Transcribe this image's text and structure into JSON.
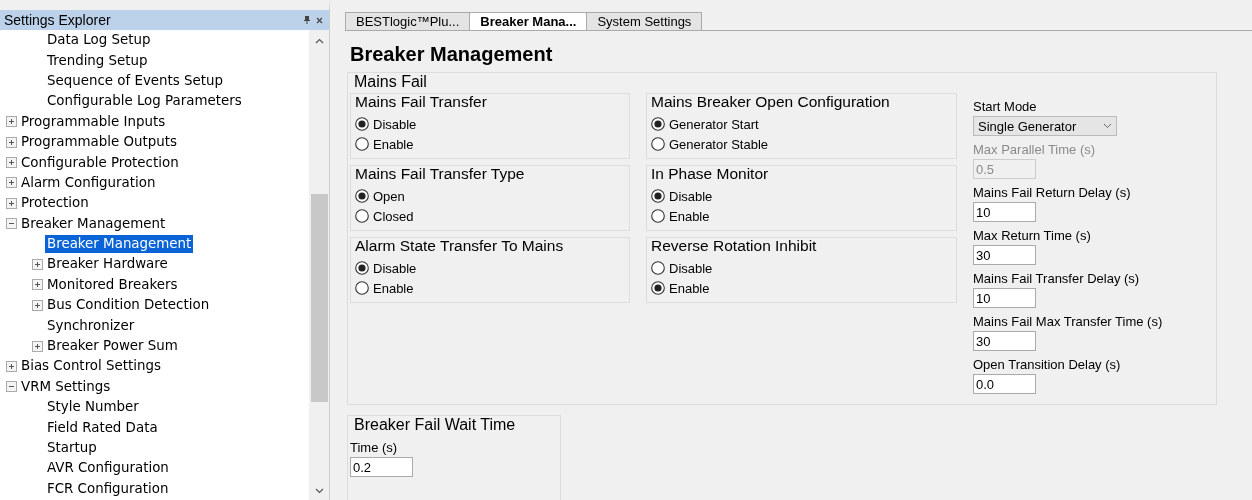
{
  "explorer": {
    "title": "Settings Explorer",
    "tree": [
      {
        "children": [
          {
            "label": "Data Log Setup",
            "selected": false
          },
          {
            "label": "Trending Setup",
            "selected": false
          },
          {
            "label": "Sequence of Events Setup",
            "selected": false
          },
          {
            "label": "Configurable Log Parameters",
            "selected": false
          }
        ]
      },
      {
        "label": "Programmable Inputs",
        "expanded": false,
        "selected": false
      },
      {
        "label": "Programmable Outputs",
        "expanded": false,
        "selected": false
      },
      {
        "label": "Configurable Protection",
        "expanded": false,
        "selected": false
      },
      {
        "label": "Alarm Configuration",
        "expanded": false,
        "selected": false
      },
      {
        "label": "Protection",
        "expanded": false,
        "selected": false
      },
      {
        "label": "Breaker Management",
        "expanded": true,
        "selected": false,
        "children": [
          {
            "label": "Breaker Management",
            "selected": true
          },
          {
            "label": "Breaker Hardware",
            "expanded": false,
            "selected": false
          },
          {
            "label": "Monitored Breakers",
            "expanded": false,
            "selected": false
          },
          {
            "label": "Bus Condition Detection",
            "expanded": false,
            "selected": false
          },
          {
            "label": "Synchronizer",
            "selected": false
          },
          {
            "label": "Breaker Power Sum",
            "expanded": false,
            "selected": false
          }
        ]
      },
      {
        "label": "Bias Control Settings",
        "expanded": false,
        "selected": false
      },
      {
        "label": "VRM Settings",
        "expanded": true,
        "selected": false,
        "children": [
          {
            "label": "Style Number",
            "selected": false
          },
          {
            "label": "Field Rated Data",
            "selected": false
          },
          {
            "label": "Startup",
            "selected": false
          },
          {
            "label": "AVR Configuration",
            "selected": false
          },
          {
            "label": "FCR Configuration",
            "selected": false
          }
        ]
      }
    ]
  },
  "tabs": [
    {
      "label": "BESTlogic™Plu...",
      "selected": false
    },
    {
      "label": "Breaker Mana...",
      "selected": true
    },
    {
      "label": "System Settings",
      "selected": false
    }
  ],
  "page": {
    "title": "Breaker Management",
    "mains_fail": {
      "title": "Mains Fail",
      "groups": [
        {
          "title": "Mains Fail Transfer",
          "options": [
            {
              "label": "Disable",
              "selected": true
            },
            {
              "label": "Enable",
              "selected": false
            }
          ]
        },
        {
          "title": "Mains Breaker Open Configuration",
          "options": [
            {
              "label": "Generator Start",
              "selected": true
            },
            {
              "label": "Generator Stable",
              "selected": false
            }
          ]
        },
        {
          "title": "Mains Fail Transfer Type",
          "options": [
            {
              "label": "Open",
              "selected": true
            },
            {
              "label": "Closed",
              "selected": false
            }
          ]
        },
        {
          "title": "In Phase Monitor",
          "options": [
            {
              "label": "Disable",
              "selected": true
            },
            {
              "label": "Enable",
              "selected": false
            }
          ]
        },
        {
          "title": "Alarm State Transfer To Mains",
          "options": [
            {
              "label": "Disable",
              "selected": true
            },
            {
              "label": "Enable",
              "selected": false
            }
          ]
        },
        {
          "title": "Reverse Rotation Inhibit",
          "options": [
            {
              "label": "Disable",
              "selected": false
            },
            {
              "label": "Enable",
              "selected": true
            }
          ]
        }
      ],
      "fields": [
        {
          "kind": "dropdown",
          "label": "Start Mode",
          "value": "Single Generator",
          "disabled": false
        },
        {
          "kind": "text",
          "label": "Max Parallel Time (s)",
          "value": "0.5",
          "disabled": true
        },
        {
          "kind": "text",
          "label": "Mains Fail Return Delay (s)",
          "value": "10",
          "disabled": false
        },
        {
          "kind": "text",
          "label": "Max Return Time (s)",
          "value": "30",
          "disabled": false
        },
        {
          "kind": "text",
          "label": "Mains Fail Transfer Delay (s)",
          "value": "10",
          "disabled": false
        },
        {
          "kind": "text",
          "label": "Mains Fail Max Transfer Time (s)",
          "value": "30",
          "disabled": false
        },
        {
          "kind": "text",
          "label": "Open Transition Delay (s)",
          "value": "0.0",
          "disabled": false
        }
      ]
    },
    "breaker_fail": {
      "title": "Breaker Fail Wait Time",
      "field": {
        "label": "Time (s)",
        "value": "0.2"
      }
    }
  }
}
